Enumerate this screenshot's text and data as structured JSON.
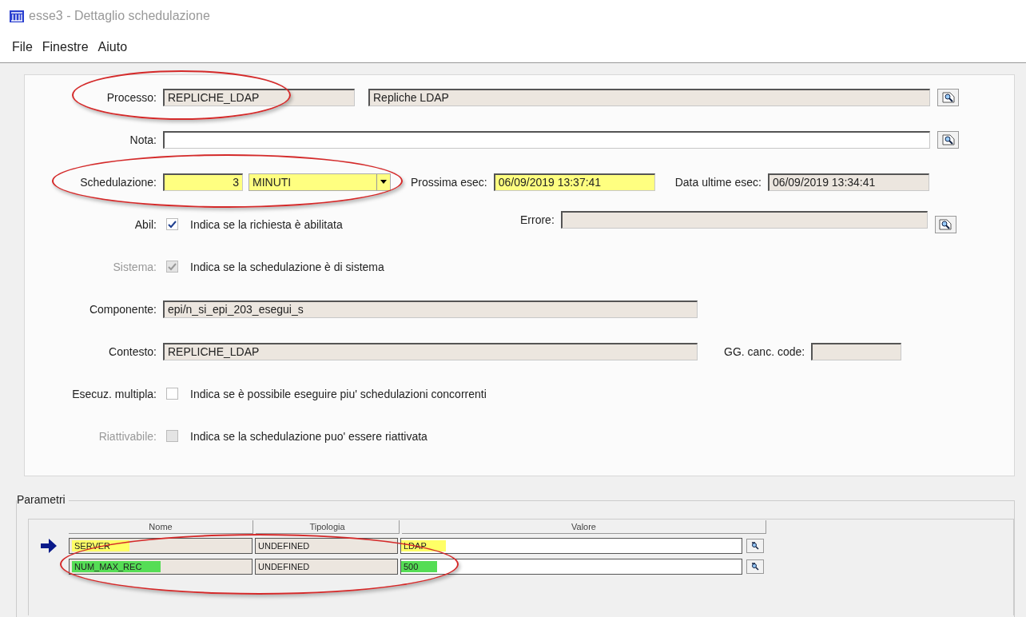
{
  "window": {
    "title": "esse3 - Dettaglio schedulazione"
  },
  "menu": [
    {
      "label": "File"
    },
    {
      "label": "Finestre"
    },
    {
      "label": "Aiuto"
    }
  ],
  "processo": {
    "label": "Processo:",
    "code": {
      "value": "REPLICHE_LDAP",
      "kind": "read_only"
    },
    "description": {
      "value": "Repliche LDAP",
      "kind": "read_only"
    }
  },
  "nota": {
    "label": "Nota:",
    "field": {
      "kind": "editable"
    }
  },
  "schedulazione": {
    "label": "Schedulazione:",
    "interval": {
      "value": "3",
      "kind": "highlighted"
    },
    "unit": {
      "value": "MINUTI",
      "highlighted": true
    },
    "next_run_label": "Prossima esec:",
    "next_run": {
      "value": "06/09/2019 13:37:41",
      "kind": "highlighted"
    },
    "last_run_label": "Data ultime esec:",
    "last_run": {
      "value": "06/09/2019 13:34:41",
      "kind": "read_only"
    }
  },
  "abil": {
    "label": "Abil:",
    "checked": true,
    "disabled": false,
    "description": "Indica se la richiesta è abilitata"
  },
  "errore": {
    "label": "Errore:",
    "field": {
      "kind": "read_only"
    }
  },
  "sistema": {
    "label": "Sistema:",
    "checked": true,
    "disabled": true,
    "description": "Indica se la schedulazione è di sistema"
  },
  "componente": {
    "label": "Componente:",
    "field": {
      "value": "epi/n_si_epi_203_esegui_s",
      "kind": "read_only"
    }
  },
  "contesto": {
    "label": "Contesto:",
    "field": {
      "value": "REPLICHE_LDAP",
      "kind": "read_only"
    }
  },
  "gg_canc": {
    "label": "GG. canc. code:",
    "field": {
      "kind": "read_only"
    }
  },
  "esecuz_multipla": {
    "label": "Esecuz. multipla:",
    "checked": false,
    "disabled": false,
    "description": "Indica se è possibile eseguire piu' schedulazioni concorrenti"
  },
  "riattivabile": {
    "label": "Riattivabile:",
    "checked": false,
    "disabled": true,
    "description": "Indica se la schedulazione puo' essere riattivata"
  },
  "parametri": {
    "title": "Parametri",
    "columns": [
      "Nome",
      "Tipologia",
      "Valore"
    ],
    "rows": [
      {
        "selected": true,
        "color": "#ffff66",
        "nome": "SERVER",
        "tipologia": "UNDEFINED",
        "valore": "LDAP"
      },
      {
        "selected": false,
        "color": "#55dd55",
        "nome": "NUM_MAX_REC",
        "tipologia": "UNDEFINED",
        "valore": "500"
      }
    ]
  }
}
